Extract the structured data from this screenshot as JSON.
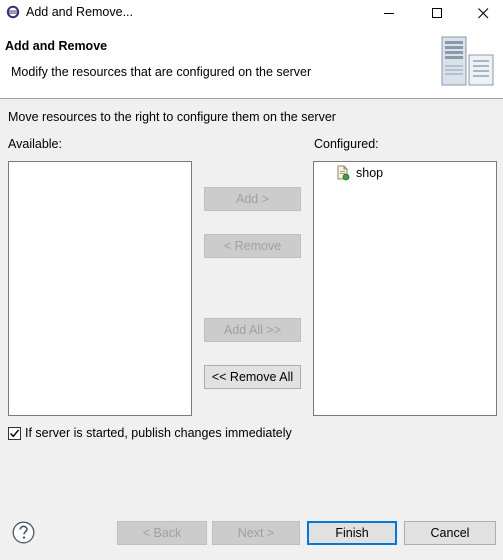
{
  "window": {
    "title": "Add and Remove..."
  },
  "header": {
    "title": "Add and Remove",
    "description": "Modify the resources that are configured on the server"
  },
  "main": {
    "instruction": "Move resources to the right to configure them on the server",
    "available_label": "Available:",
    "configured_label": "Configured:",
    "available_items": [],
    "configured_items": [
      {
        "label": "shop",
        "icon": "web-project-icon"
      }
    ],
    "buttons": {
      "add": "Add >",
      "remove": "< Remove",
      "add_all": "Add All >>",
      "remove_all": "<< Remove All"
    },
    "publish_checkbox": {
      "label": "If server is started, publish changes immediately",
      "checked": true
    }
  },
  "footer": {
    "back": "< Back",
    "next": "Next >",
    "finish": "Finish",
    "cancel": "Cancel"
  },
  "colors": {
    "accent": "#0078d7",
    "disabled_text": "#a0a0a0"
  }
}
